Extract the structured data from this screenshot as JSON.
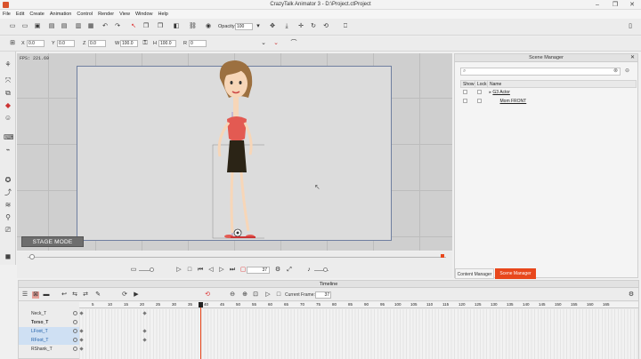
{
  "window": {
    "title": "CrazyTalk Animator 3  -  D:\\Project.ctProject",
    "controls": [
      "–",
      "❐",
      "✕"
    ]
  },
  "menu": [
    "File",
    "Edit",
    "Create",
    "Animation",
    "Control",
    "Render",
    "View",
    "Window",
    "Help"
  ],
  "toolbar": {
    "opacity_label": "Opacity",
    "opacity_value": "100"
  },
  "transform": {
    "x_label": "X",
    "x_value": "0.0",
    "y_label": "Y",
    "y_value": "0.0",
    "z_label": "Z",
    "z_value": "0.0",
    "w_label": "W",
    "w_value": "100.0",
    "h_label": "H",
    "h_value": "100.0",
    "r_label": "R",
    "r_value": "0"
  },
  "stage": {
    "fps": "FPS: 221.69",
    "mode": "STAGE MODE"
  },
  "playback": {
    "frame_value": "37"
  },
  "scene_manager": {
    "title": "Scene Manager",
    "columns": [
      "Show",
      "Lock",
      "Name"
    ],
    "items": [
      {
        "name": "G3 Actor",
        "show": true,
        "lock": false,
        "indent": 0
      },
      {
        "name": "Mom FRONT",
        "show": true,
        "lock": false,
        "indent": 1
      }
    ],
    "tabs": [
      "Content Manager",
      "Scene Manager"
    ]
  },
  "timeline": {
    "title": "Timeline",
    "current_frame_label": "Current Frame:",
    "current_frame_value": "37",
    "rulers": [
      "5",
      "10",
      "15",
      "20",
      "25",
      "30",
      "35",
      "40",
      "45",
      "50",
      "55",
      "60",
      "65",
      "70",
      "75",
      "80",
      "85",
      "90",
      "95",
      "100",
      "105",
      "110",
      "115",
      "120",
      "125",
      "130",
      "135",
      "140",
      "145",
      "150",
      "155",
      "160",
      "165"
    ],
    "tracks": [
      {
        "name": "Neck_T",
        "selected": false,
        "bold": false
      },
      {
        "name": "Torso_T",
        "selected": false,
        "bold": true
      },
      {
        "name": "LFoot_T",
        "selected": true,
        "bold": false
      },
      {
        "name": "RFoot_T",
        "selected": true,
        "bold": false
      },
      {
        "name": "RShank_T",
        "selected": false,
        "bold": false
      }
    ]
  },
  "colors": {
    "accent": "#e8471c",
    "selection": "#cfe0f3",
    "stage_bg": "#dcdcdc",
    "shirt": "#e35a52",
    "skirt": "#2b2416",
    "hair": "#9c7040"
  }
}
